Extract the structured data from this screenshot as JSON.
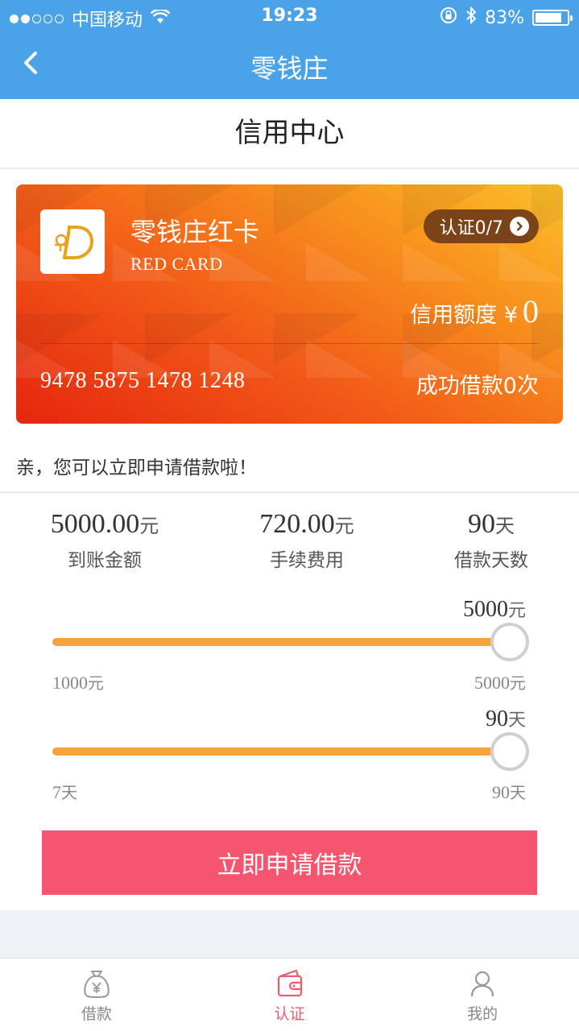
{
  "status_bar": {
    "carrier": "中国移动",
    "time": "19:23",
    "battery_text": "83%",
    "battery_level": 0.83,
    "signal_filled": 2,
    "signal_total": 5
  },
  "nav": {
    "title": "零钱庄"
  },
  "page": {
    "title": "信用中心"
  },
  "card": {
    "name": "零钱庄红卡",
    "subtitle": "RED CARD",
    "cert_label": "认证0/7",
    "credit_label": "信用额度 ¥",
    "credit_value": "0",
    "card_number": "9478 5875 1478 1248",
    "loan_count": "成功借款0次"
  },
  "hint": "亲，您可以立即申请借款啦！",
  "stats": [
    {
      "value": "5000.00",
      "unit": "元",
      "label": "到账金额"
    },
    {
      "value": "720.00",
      "unit": "元",
      "label": "手续费用"
    },
    {
      "value": "90",
      "unit": "天",
      "label": "借款天数"
    }
  ],
  "amount_slider": {
    "current": "5000",
    "unit": "元",
    "min": "1000",
    "max": "5000",
    "level": 1.0
  },
  "days_slider": {
    "current": "90",
    "unit": "天",
    "min": "7",
    "max": "90",
    "level": 1.0
  },
  "apply_button": "立即申请借款",
  "tabs": [
    {
      "label": "借款",
      "icon": "money-bag-icon",
      "active": false
    },
    {
      "label": "认证",
      "icon": "wallet-icon",
      "active": true
    },
    {
      "label": "我的",
      "icon": "user-icon",
      "active": false
    }
  ],
  "colors": {
    "header": "#4aa3e8",
    "accent": "#f5556e",
    "slider": "#f5a23c",
    "tab_active": "#f05a6e"
  }
}
